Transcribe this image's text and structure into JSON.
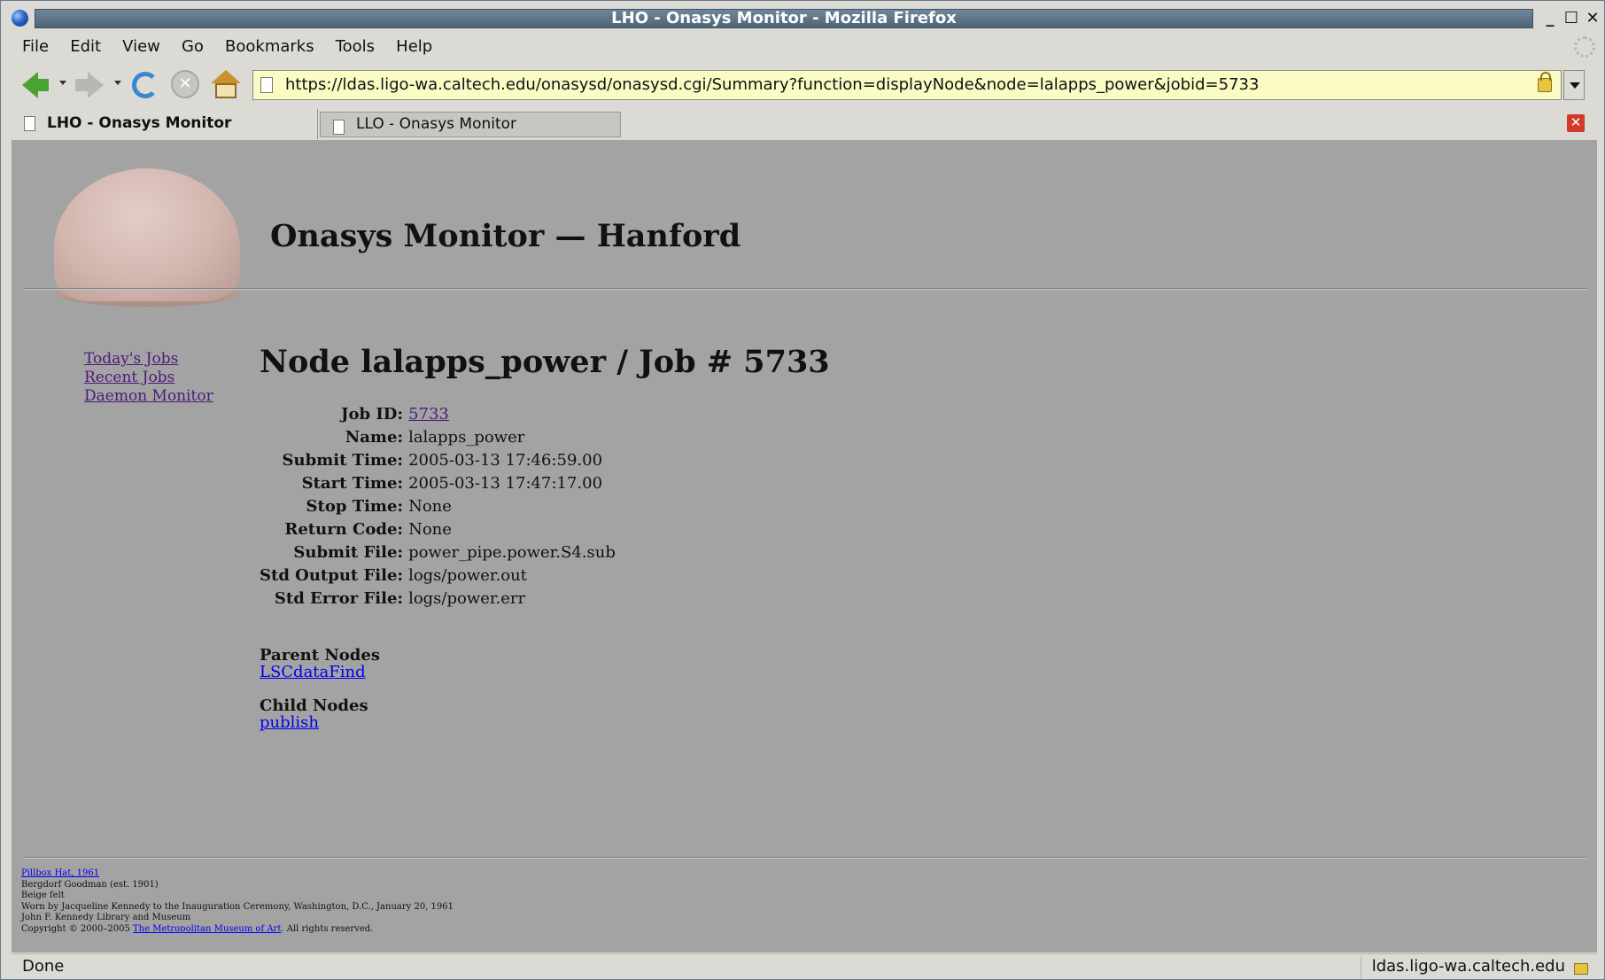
{
  "window": {
    "title": "LHO - Onasys Monitor - Mozilla Firefox",
    "controls": {
      "minimize": "_",
      "maximize": "☐",
      "close": "✕"
    }
  },
  "menu": {
    "items": [
      "File",
      "Edit",
      "View",
      "Go",
      "Bookmarks",
      "Tools",
      "Help"
    ]
  },
  "toolbar": {
    "url": "https://ldas.ligo-wa.caltech.edu/onasysd/onasysd.cgi/Summary?function=displayNode&node=lalapps_power&jobid=5733"
  },
  "tabs": [
    {
      "label": "LHO - Onasys Monitor",
      "active": true
    },
    {
      "label": "LLO - Onasys Monitor",
      "active": false
    }
  ],
  "page": {
    "site_title": "Onasys Monitor — Hanford",
    "nav": [
      "Today's  Jobs",
      "Recent Jobs",
      "Daemon Monitor"
    ],
    "heading": "Node lalapps_power / Job # 5733",
    "fields": [
      {
        "label": "Job ID:",
        "value": "5733",
        "link": true
      },
      {
        "label": "Name:",
        "value": "lalapps_power"
      },
      {
        "label": "Submit Time:",
        "value": "2005-03-13 17:46:59.00"
      },
      {
        "label": "Start Time:",
        "value": "2005-03-13 17:47:17.00"
      },
      {
        "label": "Stop Time:",
        "value": "None"
      },
      {
        "label": "Return Code:",
        "value": "None"
      },
      {
        "label": "Submit File:",
        "value": "power_pipe.power.S4.sub"
      },
      {
        "label": "Std Output File:",
        "value": "logs/power.out"
      },
      {
        "label": "Std Error File:",
        "value": "logs/power.err"
      }
    ],
    "parent_nodes": {
      "heading": "Parent Nodes",
      "link": "LSCdataFind"
    },
    "child_nodes": {
      "heading": "Child Nodes",
      "link": "publish"
    },
    "credits": {
      "title_link": "Pillbox Hat, 1961",
      "lines": [
        "Bergdorf Goodman (est. 1901)",
        "Beige felt",
        "Worn by Jacqueline Kennedy to the Inauguration Ceremony, Washington, D.C., January 20, 1961",
        "John F. Kennedy Library and Museum"
      ],
      "copyright_prefix": "Copyright © 2000–2005 ",
      "museum_link": "The Metropolitan Museum of Art",
      "copyright_suffix": ". All rights reserved."
    }
  },
  "status": {
    "text": "Done",
    "host": "ldas.ligo-wa.caltech.edu"
  }
}
